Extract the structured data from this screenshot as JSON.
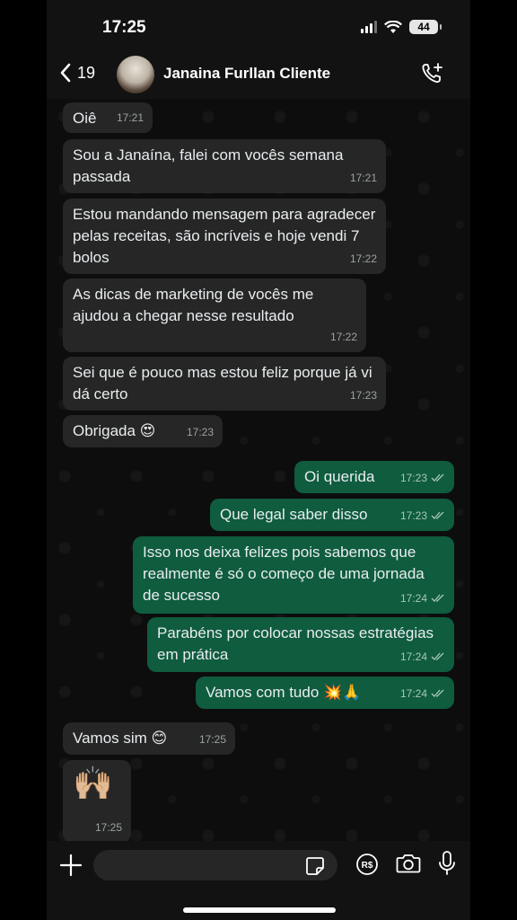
{
  "status_bar": {
    "time": "17:25",
    "battery": "44"
  },
  "header": {
    "back_count": "19",
    "contact_name": "Janaina Furllan Cliente"
  },
  "messages": [
    {
      "direction": "in",
      "text": "Oiê",
      "time": "17:21"
    },
    {
      "direction": "in",
      "text": "Sou a Janaína, falei com vocês semana passada",
      "time": "17:21"
    },
    {
      "direction": "in",
      "text": "Estou mandando mensagem para agradecer pelas receitas, são incríveis e hoje vendi 7 bolos",
      "time": "17:22"
    },
    {
      "direction": "in",
      "text": "As dicas de marketing de vocês me ajudou a chegar nesse resultado",
      "time": "17:22"
    },
    {
      "direction": "in",
      "text": "Sei que é pouco mas estou feliz porque já vi dá certo",
      "time": "17:23"
    },
    {
      "direction": "in",
      "text": "Obrigada 😍",
      "time": "17:23"
    },
    {
      "direction": "out",
      "text": "Oi querida",
      "time": "17:23"
    },
    {
      "direction": "out",
      "text": "Que legal saber disso",
      "time": "17:23"
    },
    {
      "direction": "out",
      "text": "Isso nos deixa felizes pois sabemos que realmente é só o começo de uma jornada de sucesso",
      "time": "17:24"
    },
    {
      "direction": "out",
      "text": "Parabéns por colocar nossas estratégias em prática",
      "time": "17:24"
    },
    {
      "direction": "out",
      "text": "Vamos com tudo 💥🙏",
      "time": "17:24"
    },
    {
      "direction": "in",
      "text": "Vamos sim 😊",
      "time": "17:25"
    },
    {
      "direction": "in",
      "text": "🙌🏼",
      "time": "17:25"
    }
  ],
  "colors": {
    "incoming_bubble": "#262626",
    "outgoing_bubble": "#0f5c3f",
    "background": "#0d0d0d"
  },
  "icons": [
    "chevron-left-icon",
    "add-call-icon",
    "plus-icon",
    "sticker-icon",
    "payment-icon",
    "camera-icon",
    "microphone-icon"
  ]
}
